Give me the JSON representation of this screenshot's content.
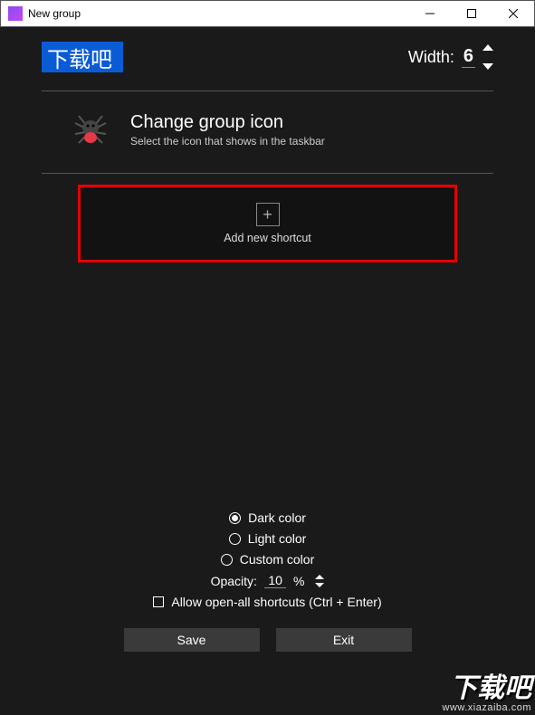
{
  "titlebar": {
    "title": "New group"
  },
  "top": {
    "group_name": "下载吧",
    "width_label": "Width:",
    "width_value": "6"
  },
  "icon_section": {
    "heading": "Change group icon",
    "subheading": "Select the icon that shows in the taskbar"
  },
  "shortcut": {
    "add_label": "Add new shortcut"
  },
  "settings": {
    "color_options": {
      "dark": "Dark color",
      "light": "Light color",
      "custom": "Custom color"
    },
    "opacity_label": "Opacity:",
    "opacity_value": "10",
    "opacity_suffix": "%",
    "allow_open_all": "Allow open-all shortcuts (Ctrl + Enter)"
  },
  "buttons": {
    "save": "Save",
    "exit": "Exit"
  },
  "watermark": {
    "text": "下载吧",
    "url": "www.xiazaiba.com"
  }
}
